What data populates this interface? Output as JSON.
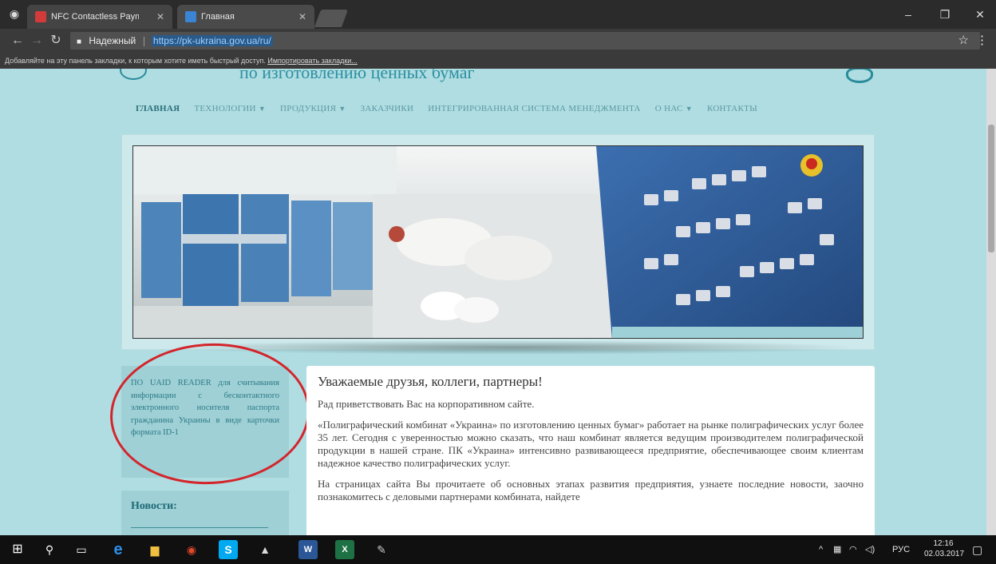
{
  "browser": {
    "tabs": [
      {
        "title": "NFC Contactless Paymen",
        "favicon_color": "#d33b3b"
      },
      {
        "title": "Главная",
        "favicon_color": "#3b83d3"
      }
    ],
    "security_label": "Надежный",
    "url": "https://pk-ukraina.gov.ua/ru/",
    "bookmarks_text": "Добавляйте на эту панель закладки, к которым хотите иметь быстрый доступ.",
    "bookmarks_link": "Импортировать закладки..."
  },
  "site": {
    "header_fragment": "по изготовлению ценных бумаг",
    "nav": [
      {
        "label": "ГЛАВНАЯ",
        "active": true,
        "dropdown": false
      },
      {
        "label": "ТЕХНОЛОГИИ",
        "active": false,
        "dropdown": true
      },
      {
        "label": "ПРОДУКЦИЯ",
        "active": false,
        "dropdown": true
      },
      {
        "label": "ЗАКАЗЧИКИ",
        "active": false,
        "dropdown": false
      },
      {
        "label": "ИНТЕГРИРОВАННАЯ СИСТЕМА МЕНЕДЖМЕНТА",
        "active": false,
        "dropdown": false
      },
      {
        "label": "О НАС",
        "active": false,
        "dropdown": true
      },
      {
        "label": "КОНТАКТЫ",
        "active": false,
        "dropdown": false
      }
    ],
    "sidebar_text": "ПО UAID READER для считывания информации с бесконтактного электронного носителя паспорта гражданина Украины в виде карточки формата ID-1",
    "news_title": "Новости:",
    "content": {
      "heading": "Уважаемые друзья, коллеги, партнеры!",
      "paragraphs": [
        "Рад приветствовать Вас на корпоративном сайте.",
        "«Полиграфический комбинат «Украина» по изготовлению ценных бумаг» работает на рынке полиграфических услуг более 35 лет. Сегодня с уверенностью можно сказать, что наш комбинат является ведущим производителем полиграфической продукции в нашей стране. ПК «Украина» интенсивно развивающееся предприятие, обеспечивающее своим клиентам надежное качество полиграфических услуг.",
        "На страницах сайта Вы прочитаете об основных этапах развития предприятия, узнаете последние новости, заочно познакомитесь с деловыми партнерами комбината, найдете"
      ]
    }
  },
  "taskbar": {
    "language": "РУС",
    "time": "12:16",
    "date": "02.03.2017"
  },
  "colors": {
    "page_bg": "#b0dde2",
    "accent": "#2a8b9a",
    "annotation_red": "#d3252b"
  }
}
